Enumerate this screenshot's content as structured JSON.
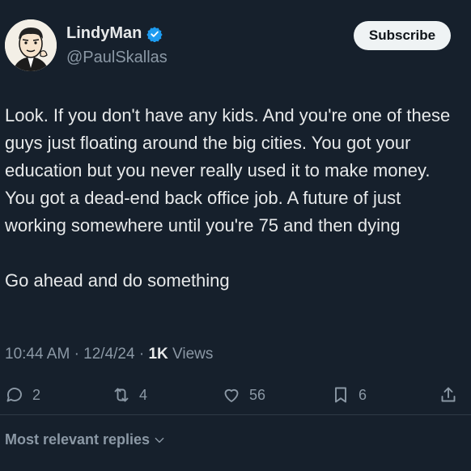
{
  "author": {
    "display_name": "LindyMan",
    "handle": "@PaulSkallas",
    "verified": true,
    "avatar": "cartoon-man-avatar"
  },
  "subscribe_label": "Subscribe",
  "tweet": {
    "paragraphs": [
      "Look. If you don't have any kids. And you're one of these guys just floating around the big cities. You got your education but you never really used it to make money. You got a dead-end back office job. A future of just working somewhere until you're 75 and then dying",
      "Go ahead and do something"
    ]
  },
  "meta": {
    "time": "10:44 AM",
    "separator": "·",
    "date": "12/4/24",
    "views_count": "1K",
    "views_label": "Views"
  },
  "actions": {
    "replies": "2",
    "reposts": "4",
    "likes": "56",
    "bookmarks": "6"
  },
  "replies_sort_label": "Most relevant replies",
  "colors": {
    "background": "#16202c",
    "text": "#e7e9ea",
    "secondary": "#8b98a5",
    "verified": "#1d9bf0"
  },
  "icons": [
    "reply-icon",
    "repost-icon",
    "like-icon",
    "bookmark-icon",
    "share-icon",
    "verified-badge-icon",
    "chevron-down-icon"
  ]
}
